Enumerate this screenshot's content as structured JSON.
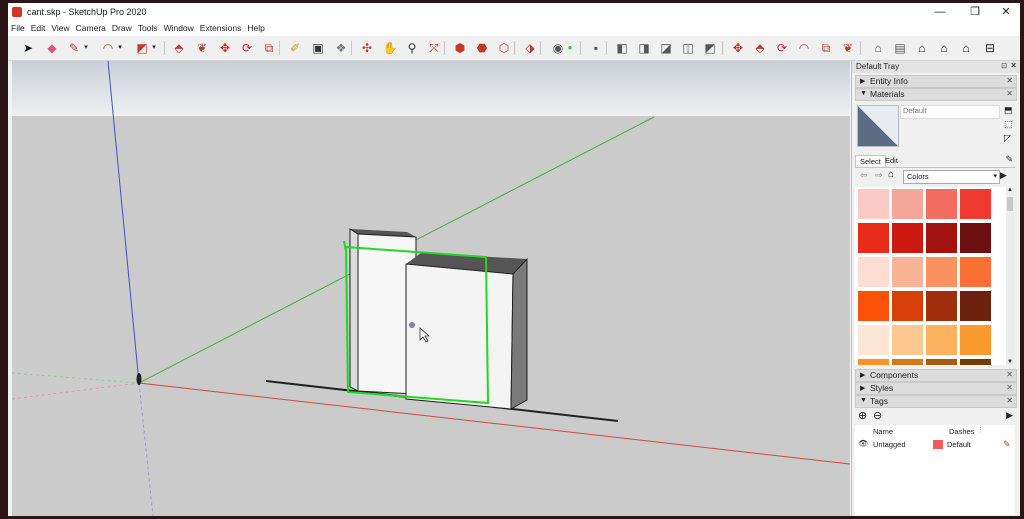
{
  "window": {
    "title": "cant.skp - SketchUp Pro 2020",
    "controls": [
      "—",
      "❐",
      "✕"
    ]
  },
  "menu": [
    "File",
    "Edit",
    "View",
    "Camera",
    "Draw",
    "Tools",
    "Window",
    "Extensions",
    "Help"
  ],
  "tray": {
    "title": "Default Tray",
    "sections": {
      "entity_info": "Entity Info",
      "materials": "Materials",
      "components": "Components",
      "styles": "Styles",
      "tags": "Tags"
    },
    "materials": {
      "current_name": "Default",
      "tabs": [
        "Select",
        "Edit"
      ],
      "library": "Colors",
      "swatch_colors": [
        "#fccac4",
        "#f6a59b",
        "#f26c60",
        "#ef3a2f",
        "#e92b1c",
        "#cc1a10",
        "#a2130f",
        "#6e0f0f",
        "#fdddd3",
        "#f9b396",
        "#f99260",
        "#fa7034",
        "#fa5307",
        "#d8400a",
        "#9f2e0c",
        "#6c220d",
        "#fde7d4",
        "#fcc791",
        "#fcb25e",
        "#fc9a32",
        "#fb9127",
        "#d77913",
        "#a45f0e",
        "#6d3f08"
      ]
    },
    "tags": {
      "columns": {
        "name": "Name",
        "dashes": "Dashes"
      },
      "rows": [
        {
          "name": "Untagged",
          "dashes": "Default",
          "color": "#ef5b55"
        }
      ]
    }
  },
  "colors": {
    "accent_red": "#d2332b",
    "axis_red": "#d8453c",
    "axis_green": "#3db43d",
    "axis_blue": "#4a4ad6",
    "selection_green": "#22d822"
  }
}
